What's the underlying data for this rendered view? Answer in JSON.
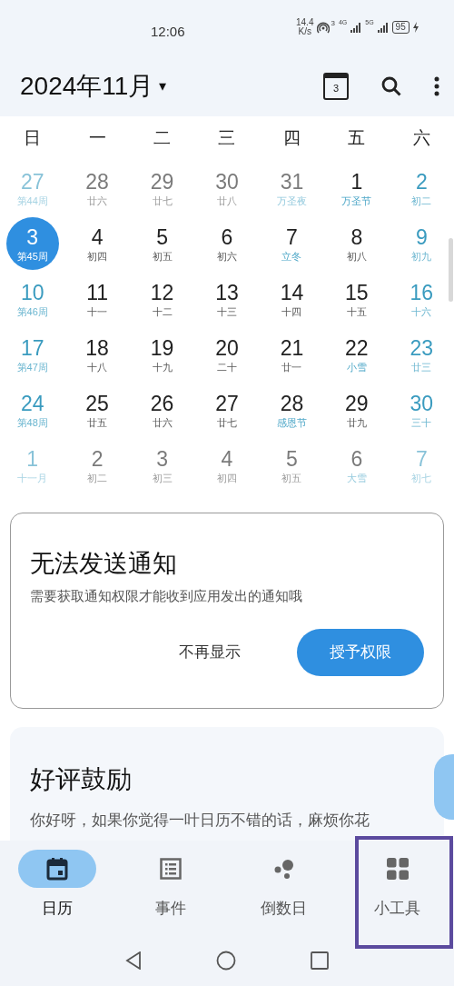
{
  "status_bar": {
    "time": "12:06",
    "speed": "14.4",
    "speed_unit": "K/s",
    "hotspot_count": "3",
    "net1": "4G",
    "net2": "5G",
    "battery": "95"
  },
  "header": {
    "title": "2024年11月",
    "dropdown": "▾",
    "calendar_badge": "3"
  },
  "weekdays": [
    "日",
    "一",
    "二",
    "三",
    "四",
    "五",
    "六"
  ],
  "weeks": [
    [
      {
        "day": "27",
        "sub": "第44周",
        "faded": true,
        "weekend": true,
        "holiday": false,
        "selected": false
      },
      {
        "day": "28",
        "sub": "廿六",
        "faded": true,
        "weekend": false,
        "holiday": false,
        "selected": false
      },
      {
        "day": "29",
        "sub": "廿七",
        "faded": true,
        "weekend": false,
        "holiday": false,
        "selected": false
      },
      {
        "day": "30",
        "sub": "廿八",
        "faded": true,
        "weekend": false,
        "holiday": false,
        "selected": false
      },
      {
        "day": "31",
        "sub": "万圣夜",
        "faded": true,
        "weekend": false,
        "holiday": true,
        "selected": false
      },
      {
        "day": "1",
        "sub": "万圣节",
        "faded": false,
        "weekend": false,
        "holiday": true,
        "selected": false
      },
      {
        "day": "2",
        "sub": "初二",
        "faded": false,
        "weekend": true,
        "holiday": false,
        "selected": false
      }
    ],
    [
      {
        "day": "3",
        "sub": "第45周",
        "faded": false,
        "weekend": true,
        "holiday": false,
        "selected": true
      },
      {
        "day": "4",
        "sub": "初四",
        "faded": false,
        "weekend": false,
        "holiday": false,
        "selected": false
      },
      {
        "day": "5",
        "sub": "初五",
        "faded": false,
        "weekend": false,
        "holiday": false,
        "selected": false
      },
      {
        "day": "6",
        "sub": "初六",
        "faded": false,
        "weekend": false,
        "holiday": false,
        "selected": false
      },
      {
        "day": "7",
        "sub": "立冬",
        "faded": false,
        "weekend": false,
        "holiday": true,
        "selected": false
      },
      {
        "day": "8",
        "sub": "初八",
        "faded": false,
        "weekend": false,
        "holiday": false,
        "selected": false
      },
      {
        "day": "9",
        "sub": "初九",
        "faded": false,
        "weekend": true,
        "holiday": false,
        "selected": false
      }
    ],
    [
      {
        "day": "10",
        "sub": "第46周",
        "faded": false,
        "weekend": true,
        "holiday": false,
        "selected": false
      },
      {
        "day": "11",
        "sub": "十一",
        "faded": false,
        "weekend": false,
        "holiday": false,
        "selected": false
      },
      {
        "day": "12",
        "sub": "十二",
        "faded": false,
        "weekend": false,
        "holiday": false,
        "selected": false
      },
      {
        "day": "13",
        "sub": "十三",
        "faded": false,
        "weekend": false,
        "holiday": false,
        "selected": false
      },
      {
        "day": "14",
        "sub": "十四",
        "faded": false,
        "weekend": false,
        "holiday": false,
        "selected": false
      },
      {
        "day": "15",
        "sub": "十五",
        "faded": false,
        "weekend": false,
        "holiday": false,
        "selected": false
      },
      {
        "day": "16",
        "sub": "十六",
        "faded": false,
        "weekend": true,
        "holiday": false,
        "selected": false
      }
    ],
    [
      {
        "day": "17",
        "sub": "第47周",
        "faded": false,
        "weekend": true,
        "holiday": false,
        "selected": false
      },
      {
        "day": "18",
        "sub": "十八",
        "faded": false,
        "weekend": false,
        "holiday": false,
        "selected": false
      },
      {
        "day": "19",
        "sub": "十九",
        "faded": false,
        "weekend": false,
        "holiday": false,
        "selected": false
      },
      {
        "day": "20",
        "sub": "二十",
        "faded": false,
        "weekend": false,
        "holiday": false,
        "selected": false
      },
      {
        "day": "21",
        "sub": "廿一",
        "faded": false,
        "weekend": false,
        "holiday": false,
        "selected": false
      },
      {
        "day": "22",
        "sub": "小雪",
        "faded": false,
        "weekend": false,
        "holiday": true,
        "selected": false
      },
      {
        "day": "23",
        "sub": "廿三",
        "faded": false,
        "weekend": true,
        "holiday": false,
        "selected": false
      }
    ],
    [
      {
        "day": "24",
        "sub": "第48周",
        "faded": false,
        "weekend": true,
        "holiday": false,
        "selected": false
      },
      {
        "day": "25",
        "sub": "廿五",
        "faded": false,
        "weekend": false,
        "holiday": false,
        "selected": false
      },
      {
        "day": "26",
        "sub": "廿六",
        "faded": false,
        "weekend": false,
        "holiday": false,
        "selected": false
      },
      {
        "day": "27",
        "sub": "廿七",
        "faded": false,
        "weekend": false,
        "holiday": false,
        "selected": false
      },
      {
        "day": "28",
        "sub": "感恩节",
        "faded": false,
        "weekend": false,
        "holiday": true,
        "selected": false
      },
      {
        "day": "29",
        "sub": "廿九",
        "faded": false,
        "weekend": false,
        "holiday": false,
        "selected": false
      },
      {
        "day": "30",
        "sub": "三十",
        "faded": false,
        "weekend": true,
        "holiday": false,
        "selected": false
      }
    ],
    [
      {
        "day": "1",
        "sub": "十一月",
        "faded": true,
        "weekend": true,
        "holiday": false,
        "selected": false
      },
      {
        "day": "2",
        "sub": "初二",
        "faded": true,
        "weekend": false,
        "holiday": false,
        "selected": false
      },
      {
        "day": "3",
        "sub": "初三",
        "faded": true,
        "weekend": false,
        "holiday": false,
        "selected": false
      },
      {
        "day": "4",
        "sub": "初四",
        "faded": true,
        "weekend": false,
        "holiday": false,
        "selected": false
      },
      {
        "day": "5",
        "sub": "初五",
        "faded": true,
        "weekend": false,
        "holiday": false,
        "selected": false
      },
      {
        "day": "6",
        "sub": "大雪",
        "faded": true,
        "weekend": false,
        "holiday": true,
        "selected": false
      },
      {
        "day": "7",
        "sub": "初七",
        "faded": true,
        "weekend": true,
        "holiday": false,
        "selected": false
      }
    ]
  ],
  "notice_card": {
    "title": "无法发送通知",
    "text": "需要获取通知权限才能收到应用发出的通知哦",
    "dismiss": "不再显示",
    "grant": "授予权限"
  },
  "review_card": {
    "title": "好评鼓励",
    "text": "你好呀，如果你觉得一叶日历不错的话，麻烦你花"
  },
  "nav": [
    {
      "kind": "calendar",
      "label": "日历",
      "selected": true,
      "highlighted": false
    },
    {
      "kind": "list",
      "label": "事件",
      "selected": false,
      "highlighted": false
    },
    {
      "kind": "dots",
      "label": "倒数日",
      "selected": false,
      "highlighted": false
    },
    {
      "kind": "grid",
      "label": "小工具",
      "selected": false,
      "highlighted": true
    }
  ]
}
